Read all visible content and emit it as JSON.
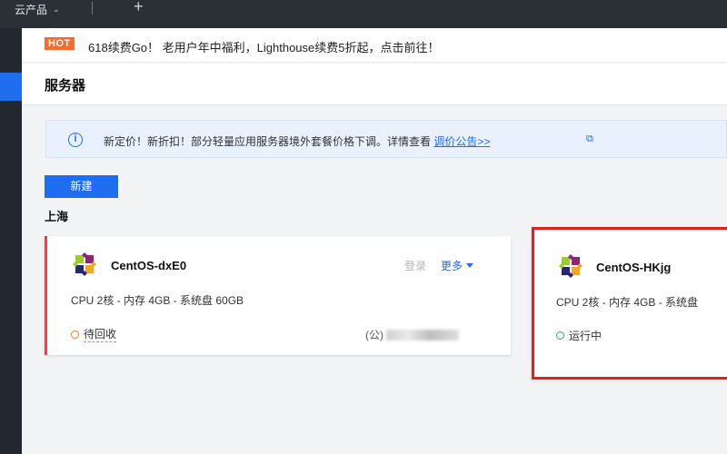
{
  "topbar": {
    "product_menu": "云产品",
    "add_symbol": "+"
  },
  "banner": {
    "badge": "HOT",
    "text": "618续费Go！ 老用户年中福利，Lighthouse续费5折起，点击前往！"
  },
  "page": {
    "title": "服务器"
  },
  "notice": {
    "text": "新定价！新折扣！部分轻量应用服务器境外套餐价格下调。详情查看 ",
    "link": "调价公告>>"
  },
  "actions": {
    "new_label": "新建"
  },
  "region": "上海",
  "servers": [
    {
      "name": "CentOS-dxE0",
      "spec": "CPU 2核 - 内存 4GB - 系统盘 60GB",
      "status": "待回收",
      "login_label": "登录",
      "more_label": "更多",
      "ip_prefix": "(公)"
    },
    {
      "name": "CentOS-HKjg",
      "spec": "CPU 2核 - 内存 4GB - 系统盘",
      "status": "运行中"
    }
  ],
  "colors": {
    "accent": "#1f6ef0",
    "status_pending": "#ff7a1a",
    "status_running": "#29b24a",
    "hot": "#ff6a2b",
    "highlight": "#e02020"
  }
}
